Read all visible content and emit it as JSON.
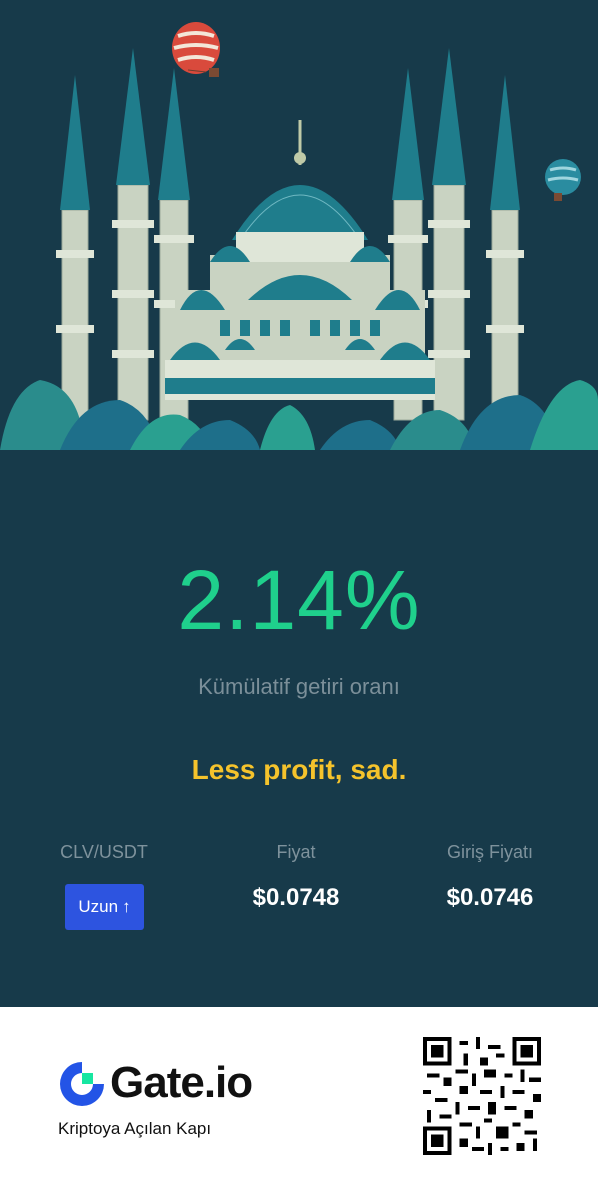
{
  "stats": {
    "profit_rate": "2.14%",
    "profit_label": "Kümülatif getiri oranı",
    "message": "Less profit, sad."
  },
  "trade": {
    "pair": "CLV/USDT",
    "direction_label": "Uzun",
    "direction_arrow": "↑",
    "price_label": "Fiyat",
    "price_value": "$0.0748",
    "entry_label": "Giriş Fiyatı",
    "entry_value": "$0.0746"
  },
  "brand": {
    "name": "Gate.io",
    "tagline": "Kriptoya Açılan Kapı"
  },
  "colors": {
    "background": "#173a4a",
    "profit": "#1fd08c",
    "message": "#f5c32c",
    "button": "#2d54e0"
  },
  "icons": [
    "mosque-illustration",
    "hot-air-balloon-icon",
    "gate-logo-icon",
    "qr-code"
  ]
}
